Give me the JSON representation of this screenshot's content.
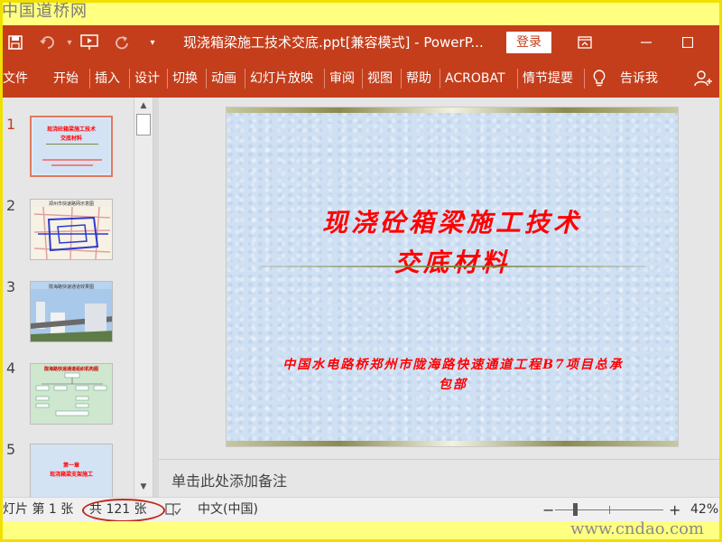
{
  "watermark": {
    "top": "中国道桥网",
    "bottom": "www.cndao.com"
  },
  "titlebar": {
    "title": "现浇箱梁施工技术交底.ppt[兼容模式] - PowerP...",
    "login_label": "登录"
  },
  "ribbon": {
    "tabs": [
      "文件",
      "开始",
      "插入",
      "设计",
      "切换",
      "动画",
      "幻灯片放映",
      "审阅",
      "视图",
      "帮助",
      "ACROBAT",
      "情节提要"
    ],
    "tell_me": "告诉我"
  },
  "thumbnails": {
    "numbers": [
      "1",
      "2",
      "3",
      "4",
      "5"
    ],
    "slide1_title_line1": "现浇砼箱梁施工技术",
    "slide1_title_line2": "交底材料",
    "slide2_title": "郑州市快速路网示意图",
    "slide3_title": "陇海路快速通道效果图",
    "slide4_title": "陇海路快速通道组织机构图",
    "slide5_line1": "第一章",
    "slide5_line2": "现浇箱梁支架施工"
  },
  "slide": {
    "title_line1": "现浇砼箱梁施工技术",
    "title_line2": "交底材料",
    "subtitle": "中国水电路桥郑州市陇海路快速通道工程B7项目总承包部"
  },
  "notes": {
    "placeholder": "单击此处添加备注"
  },
  "statusbar": {
    "slide_position": "灯片 第 1 张",
    "slide_total": "共 121 张",
    "language": "中文(中国)",
    "zoom_minus": "−",
    "zoom_plus": "+",
    "zoom_level": "42%",
    "zoom_fraction": 0.42
  },
  "colors": {
    "accent": "#c43e1c",
    "slide_text": "#ff0000",
    "highlight_oval": "#c0281c",
    "frame": "#f0e000"
  }
}
